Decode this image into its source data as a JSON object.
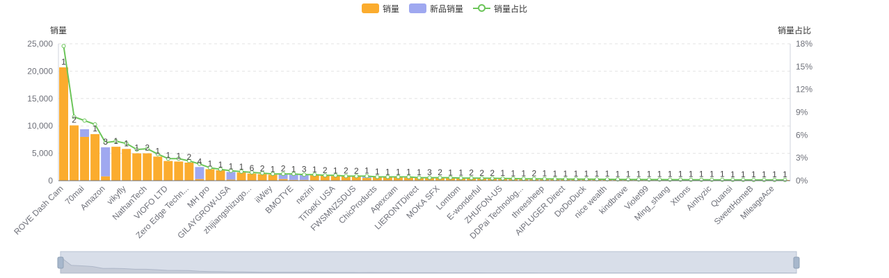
{
  "legend": {
    "sales": "销量",
    "new_sales": "新品销量",
    "share": "销量占比"
  },
  "colors": {
    "sales": "#fbac2e",
    "new_sales": "#9fa8f0",
    "share": "#6cc55a",
    "grid": "#e3e3e3",
    "axis_text": "#6e7079",
    "label": "#444444",
    "zoom_bg": "#d8dee9",
    "zoom_border": "#b7c1d3",
    "zoom_area": "#c6ccd8"
  },
  "chart_data": {
    "type": "bar",
    "yname_left": "销量",
    "yname_right": "销量占比",
    "ylim_left": [
      0,
      25000
    ],
    "yticks_left": [
      "0",
      "5,000",
      "10,000",
      "15,000",
      "20,000",
      "25,000"
    ],
    "ylim_right": [
      0,
      18
    ],
    "yticks_right": [
      "0%",
      "3%",
      "6%",
      "9%",
      "12%",
      "15%",
      "18%"
    ],
    "grid": true,
    "categories": [
      "ROVE Dash Cam",
      "",
      "70mai",
      "",
      "Amazon",
      "",
      "vikyfly",
      "",
      "NathanTech",
      "",
      "VIOFO LTD",
      "",
      "Zero Edge Techn...",
      "",
      "MH pro",
      "",
      "GILAYGROW-USA",
      "",
      "zhijiangshizugo...",
      "",
      "iiWey",
      "",
      "BMOTYE",
      "",
      "nezini",
      "",
      "TiToeKi USA",
      "",
      "FWSMNZSDUS",
      "",
      "ChicProducts",
      "",
      "Apexcam",
      "",
      "LIERONTDirect",
      "",
      "MOKA SFX",
      "",
      "Lomtom",
      "",
      "E-wonderful",
      "",
      "ZHUFON-US",
      "",
      "DDPai Technolog...",
      "",
      "threesheep",
      "",
      "AIPLUGER Direct",
      "",
      "DoDoDuck",
      "",
      "nice wealth",
      "",
      "kindbrave",
      "",
      "Violet99",
      "",
      "Ming_shang",
      "",
      "Xtrons",
      "",
      "Ainhyzic",
      "",
      "Quansi",
      "",
      "SweetHomeB",
      "",
      "MileageAce",
      ""
    ],
    "series": [
      {
        "name": "销量",
        "values": [
          20700,
          10100,
          8000,
          8500,
          800,
          6200,
          5800,
          5000,
          5000,
          4400,
          3600,
          3500,
          3300,
          300,
          2100,
          1900,
          200,
          1500,
          1300,
          1200,
          1100,
          300,
          150,
          150,
          1000,
          900,
          850,
          800,
          750,
          500,
          650,
          600,
          580,
          550,
          530,
          500,
          480,
          460,
          440,
          420,
          400,
          380,
          360,
          340,
          320,
          300,
          290,
          280,
          270,
          260,
          250,
          240,
          230,
          220,
          210,
          200,
          195,
          190,
          185,
          180,
          175,
          170,
          165,
          160,
          155,
          150,
          145,
          140,
          135,
          130
        ]
      },
      {
        "name": "新品销量",
        "values": [
          0,
          0,
          1400,
          0,
          5300,
          0,
          0,
          0,
          0,
          0,
          0,
          0,
          0,
          2200,
          0,
          0,
          1400,
          0,
          0,
          0,
          0,
          900,
          950,
          950,
          0,
          0,
          0,
          0,
          0,
          300,
          0,
          0,
          0,
          0,
          0,
          0,
          0,
          0,
          0,
          0,
          0,
          0,
          0,
          0,
          0,
          0,
          0,
          0,
          0,
          0,
          0,
          0,
          0,
          0,
          0,
          0,
          0,
          0,
          0,
          0,
          0,
          0,
          0,
          0,
          0,
          0,
          0,
          0,
          0,
          0
        ]
      },
      {
        "name": "销量占比",
        "values": [
          17.7,
          8.4,
          7.9,
          7.4,
          5.0,
          5.2,
          4.9,
          4.1,
          4.2,
          3.5,
          2.9,
          2.9,
          2.6,
          2.2,
          1.7,
          1.5,
          1.3,
          1.2,
          1.1,
          1.0,
          0.9,
          0.9,
          0.9,
          0.8,
          0.8,
          0.7,
          0.7,
          0.6,
          0.6,
          0.6,
          0.5,
          0.5,
          0.5,
          0.5,
          0.4,
          0.4,
          0.4,
          0.4,
          0.35,
          0.35,
          0.33,
          0.32,
          0.3,
          0.28,
          0.26,
          0.25,
          0.24,
          0.23,
          0.22,
          0.21,
          0.2,
          0.19,
          0.18,
          0.17,
          0.16,
          0.16,
          0.15,
          0.15,
          0.14,
          0.14,
          0.13,
          0.13,
          0.12,
          0.12,
          0.11,
          0.11,
          0.1,
          0.1,
          0.1,
          0.1
        ]
      }
    ],
    "bar_labels": [
      "1",
      "2",
      "",
      "1",
      "3",
      "1",
      "1",
      "1",
      "2",
      "1",
      "1",
      "1",
      "2",
      "4",
      "1",
      "1",
      "1",
      "1",
      "6",
      "2",
      "1",
      "2",
      "1",
      "3",
      "1",
      "2",
      "1",
      "2",
      "2",
      "1",
      "1",
      "1",
      "1",
      "1",
      "1",
      "3",
      "2",
      "1",
      "1",
      "2",
      "2",
      "2",
      "1",
      "1",
      "1",
      "2",
      "1",
      "1",
      "1",
      "1",
      "1",
      "1",
      "1",
      "1",
      "1",
      "1",
      "1",
      "1",
      "1",
      "1",
      "1",
      "1",
      "1",
      "1",
      "1",
      "1",
      "1",
      "1",
      "1",
      "1"
    ],
    "has_data_zoom": true
  }
}
